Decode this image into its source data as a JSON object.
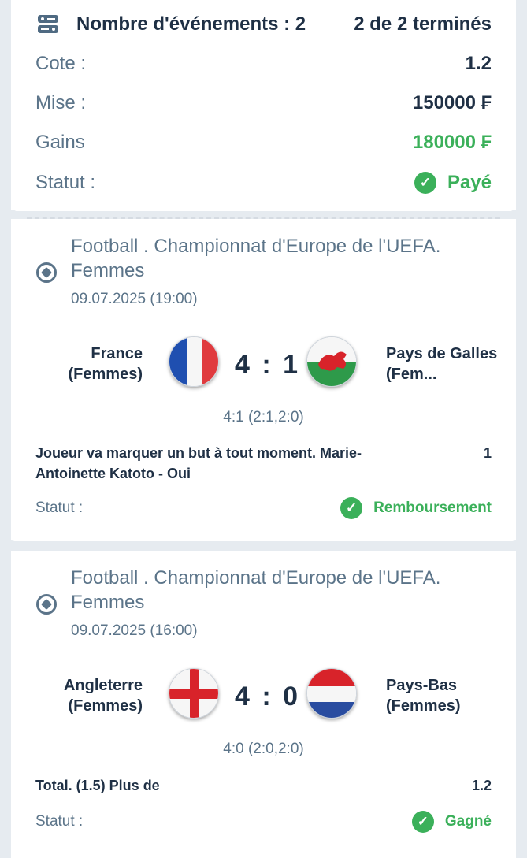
{
  "summary": {
    "events_label": "Nombre d'événements : 2",
    "events_done": "2 de 2 terminés",
    "rows": [
      {
        "label": "Cote :",
        "value": "1.2"
      },
      {
        "label": "Mise :",
        "value": "150000 ₣"
      },
      {
        "label": "Gains",
        "value": "180000 ₣"
      }
    ],
    "status_label": "Statut :",
    "status_value": "Payé"
  },
  "events": [
    {
      "league": "Football . Championnat d'Europe de l'UEFA. Femmes",
      "date": "09.07.2025 (19:00)",
      "home": "France (Femmes)",
      "away": "Pays de Galles (Fem...",
      "score": "4 : 1",
      "detail": "4:1 (2:1,2:0)",
      "market": "Joueur va marquer un but à tout moment. Marie-Antoinette Katoto - Oui",
      "odds": "1",
      "status_label": "Statut :",
      "status_value": "Remboursement"
    },
    {
      "league": "Football . Championnat d'Europe de l'UEFA. Femmes",
      "date": "09.07.2025 (16:00)",
      "home": "Angleterre (Femmes)",
      "away": "Pays-Bas (Femmes)",
      "score": "4 : 0",
      "detail": "4:0 (2:0,2:0)",
      "market": "Total. (1.5) Plus de",
      "odds": "1.2",
      "status_label": "Statut :",
      "status_value": "Gagné"
    }
  ],
  "icons": {
    "summary": "events-list-icon",
    "sport": "football-icon",
    "status": "check-circle-icon"
  },
  "colors": {
    "accent_green": "#3bb05a",
    "text_dark": "#1f3045",
    "text_muted": "#5b7489",
    "background": "#e6ebf0"
  }
}
